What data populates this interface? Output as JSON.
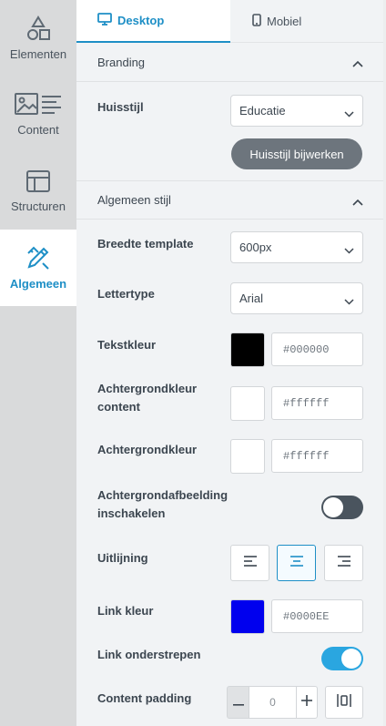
{
  "sidebar": {
    "items": [
      {
        "label": "Elementen",
        "icon": "shapes-icon"
      },
      {
        "label": "Content",
        "icon": "image-text-icon"
      },
      {
        "label": "Structuren",
        "icon": "layout-icon"
      },
      {
        "label": "Algemeen",
        "icon": "pen-ruler-icon",
        "active": true
      }
    ]
  },
  "tabs": [
    {
      "label": "Desktop",
      "icon": "monitor-icon",
      "active": true
    },
    {
      "label": "Mobiel",
      "icon": "phone-icon"
    }
  ],
  "branding": {
    "title": "Branding",
    "huisstijl_label": "Huisstijl",
    "huisstijl_value": "Educatie",
    "update_button": "Huisstijl bijwerken"
  },
  "general": {
    "title": "Algemeen stijl",
    "template_width_label": "Breedte template",
    "template_width_value": "600px",
    "font_label": "Lettertype",
    "font_value": "Arial",
    "text_color_label": "Tekstkleur",
    "text_color": "#000000",
    "content_bg_label": "Achtergrondkleur content",
    "content_bg_color": "#ffffff",
    "bg_label": "Achtergrondkleur",
    "bg_color": "#ffffff",
    "bg_image_label": "Achtergrondafbeelding inschakelen",
    "bg_image_enabled": false,
    "alignment_label": "Uitlijning",
    "alignment_selected": "center",
    "link_color_label": "Link kleur",
    "link_color": "#0000EE",
    "link_underline_label": "Link onderstrepen",
    "link_underline_enabled": true,
    "content_padding_label": "Content padding",
    "content_padding_value": "0"
  },
  "colors": {
    "accent": "#1e8fc6",
    "toggle_on": "#2aa6e0",
    "toggle_off": "#4a545e",
    "button_gray": "#6d757d"
  }
}
